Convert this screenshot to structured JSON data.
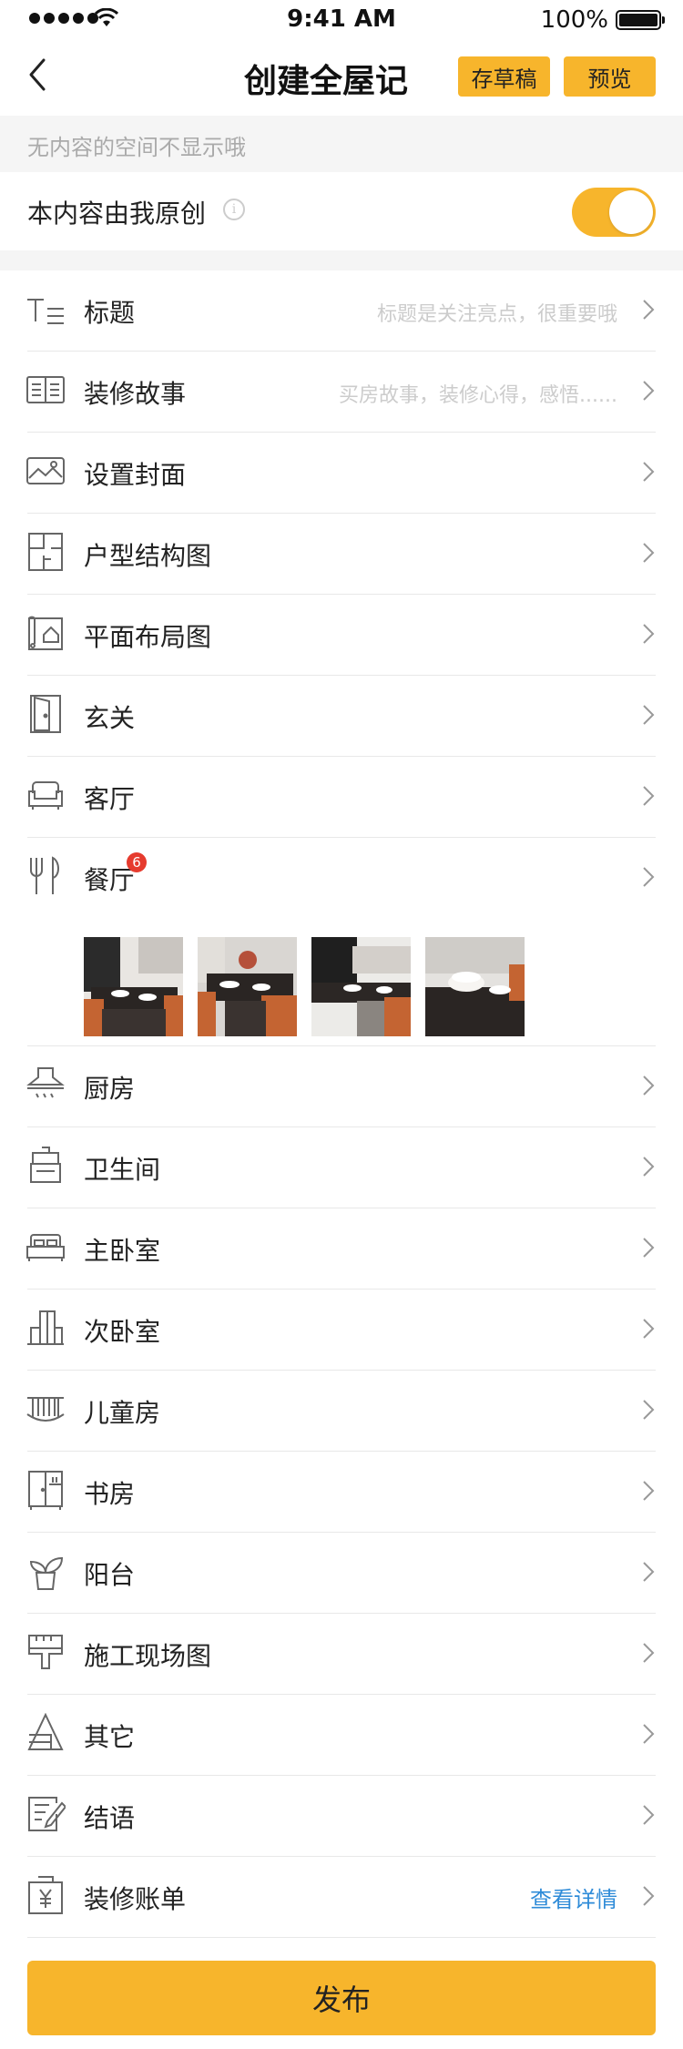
{
  "status_bar": {
    "time": "9:41 AM",
    "battery": "100%"
  },
  "nav": {
    "title": "创建全屋记",
    "draft_label": "存草稿",
    "preview_label": "预览"
  },
  "notice": "无内容的空间不显示哦",
  "original": {
    "label": "本内容由我原创",
    "enabled": true
  },
  "rows": [
    {
      "icon": "title-icon",
      "label": "标题",
      "hint": "标题是关注亮点，很重要哦"
    },
    {
      "icon": "book-icon",
      "label": "装修故事",
      "hint": "买房故事，装修心得，感悟......"
    },
    {
      "icon": "image-icon",
      "label": "设置封面"
    },
    {
      "icon": "floorplan-icon",
      "label": "户型结构图"
    },
    {
      "icon": "blueprint-icon",
      "label": "平面布局图"
    },
    {
      "icon": "door-icon",
      "label": "玄关"
    },
    {
      "icon": "sofa-icon",
      "label": "客厅"
    },
    {
      "icon": "fork-knife-icon",
      "label": "餐厅",
      "badge": "6"
    },
    {
      "icon": "range-hood-icon",
      "label": "厨房"
    },
    {
      "icon": "toilet-icon",
      "label": "卫生间"
    },
    {
      "icon": "bed-icon",
      "label": "主卧室"
    },
    {
      "icon": "wardrobe-icon",
      "label": "次卧室"
    },
    {
      "icon": "crib-icon",
      "label": "儿童房"
    },
    {
      "icon": "bookcase-icon",
      "label": "书房"
    },
    {
      "icon": "plant-icon",
      "label": "阳台"
    },
    {
      "icon": "paint-brush-icon",
      "label": "施工现场图"
    },
    {
      "icon": "misc-icon",
      "label": "其它"
    },
    {
      "icon": "edit-icon",
      "label": "结语"
    },
    {
      "icon": "bill-icon",
      "label": "装修账单",
      "link": "查看详情"
    }
  ],
  "publish_label": "发布",
  "colors": {
    "accent": "#f7b52c",
    "link": "#2e8bd8",
    "badge": "#e63b2e"
  }
}
